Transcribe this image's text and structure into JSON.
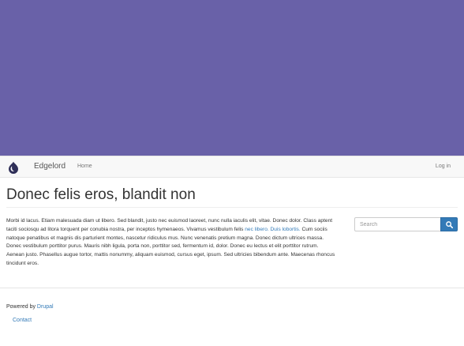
{
  "navbar": {
    "brand": "Edgelord",
    "home": "Home",
    "login": "Log in",
    "logo_icon": "drupal-drop-icon"
  },
  "main": {
    "title": "Donec felis eros, blandit non",
    "paragraph": {
      "text1": "Morbi id lacus. Etiam malesuada diam ut libero. Sed blandit, justo nec euismod laoreet, nunc nulla iaculis elit, vitae. Donec dolor. Class aptent taciti sociosqu ad litora torquent per conubia nostra, per inceptos hymenaeos. Vivamus vestibulum felis ",
      "link1": "nec libero.",
      "link2": "Duis lobortis.",
      "text2": " Cum sociis natoque penatibus et magnis dis parturient montes, nascetur ridiculus mus. Nunc venenatis pretium magna. Donec dictum ultrices massa. Donec vestibulum porttitor purus. Mauris nibh ligula, porta non, porttitor sed, fermentum id, dolor. Donec eu lectus et elit porttitor rutrum. Aenean justo. Phasellus augue tortor, mattis nonummy, aliquam euismod, cursus eget, ipsum. Sed ultricies bibendum ante. Maecenas rhoncus tincidunt eros."
    }
  },
  "search": {
    "placeholder": "Search",
    "button_icon": "search-icon"
  },
  "footer": {
    "powered_by": "Powered by",
    "drupal": "Drupal",
    "contact": "Contact"
  },
  "colors": {
    "hero": "#6961a8",
    "link": "#337ab7",
    "navbar": "#f8f8f8"
  }
}
